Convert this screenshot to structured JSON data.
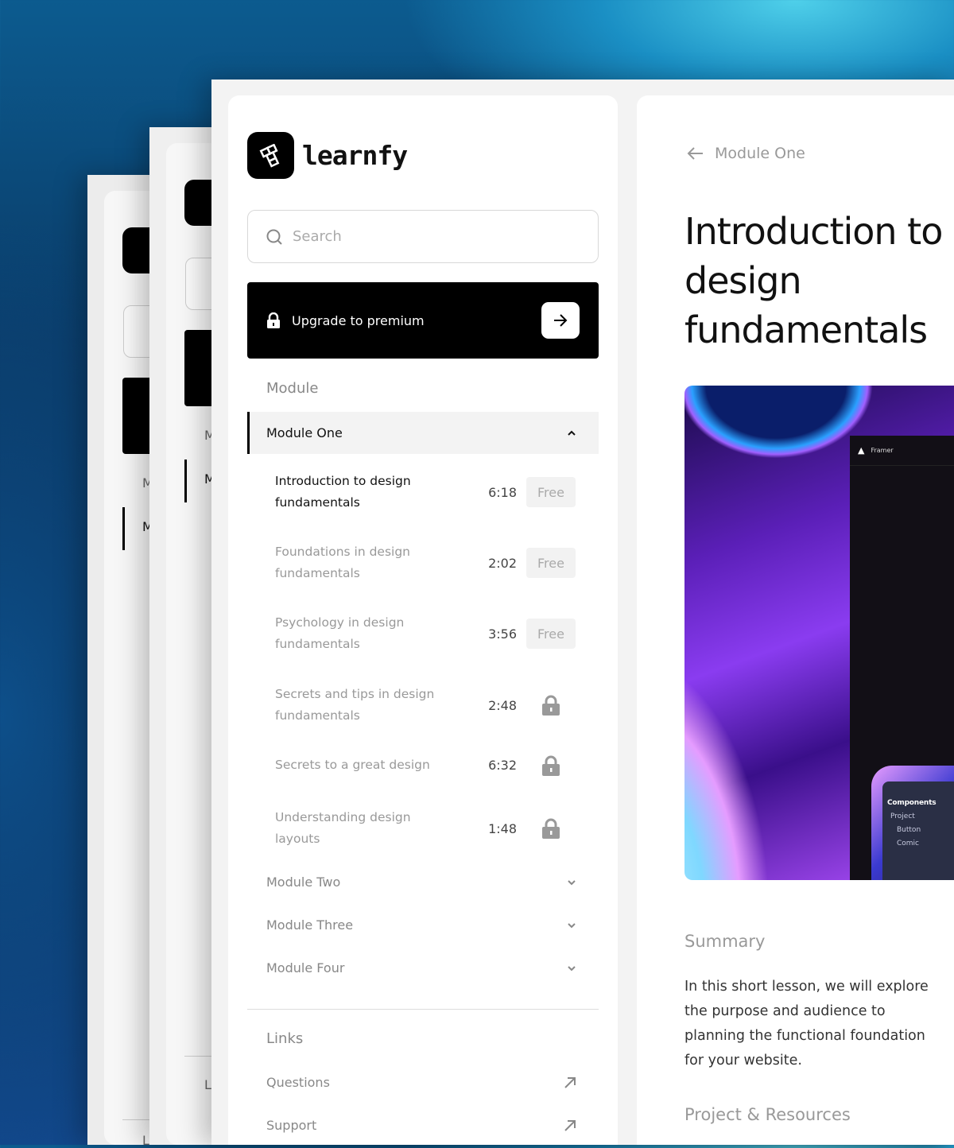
{
  "brand": {
    "name": "learnfy"
  },
  "search": {
    "placeholder": "Search"
  },
  "upgrade": {
    "label": "Upgrade to premium"
  },
  "sidebar": {
    "module_heading": "Module",
    "open_module": "Module One",
    "lessons": [
      {
        "title": "Introduction to design fundamentals",
        "duration": "6:18",
        "access": "Free",
        "active": true
      },
      {
        "title": "Foundations in design fundamentals",
        "duration": "2:02",
        "access": "Free"
      },
      {
        "title": "Psychology in design fundamentals",
        "duration": "3:56",
        "access": "Free"
      },
      {
        "title": "Secrets and tips in design fundamentals",
        "duration": "2:48",
        "access": "lock-icon"
      },
      {
        "title": "Secrets to a great design",
        "duration": "6:32",
        "access": "lock-icon"
      },
      {
        "title": "Understanding design layouts",
        "duration": "1:48",
        "access": "lock-icon"
      }
    ],
    "modules": [
      "Module Two",
      "Module Three",
      "Module Four"
    ],
    "links_heading": "Links",
    "links": [
      "Questions",
      "Support"
    ]
  },
  "content": {
    "back_label": "Module One",
    "title_line1": "Introduction to",
    "title_line2": "design fundamentals",
    "hero": {
      "app_name": "Framer",
      "panel_heading": "Components",
      "panel_items": [
        "Project",
        "Button",
        "Comic"
      ]
    },
    "summary_heading": "Summary",
    "summary_lines": [
      "In this short lesson, we will explore the",
      "purpose and audience to planning the",
      "functional foundation for your website."
    ],
    "resources_heading": "Project & Resources"
  },
  "back_cards": {
    "letters": [
      "M",
      "M",
      "L"
    ]
  }
}
